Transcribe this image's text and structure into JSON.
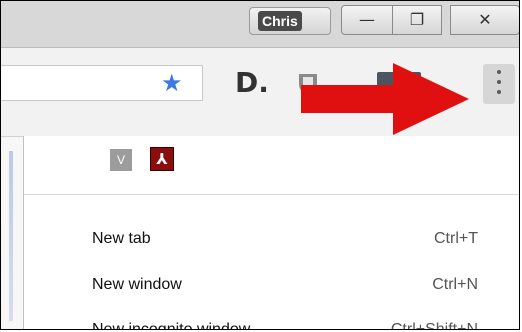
{
  "titlebar": {
    "profile_name": "Chris",
    "minimize_glyph": "—",
    "maximize_glyph": "❐",
    "close_glyph": "✕"
  },
  "toolbar": {
    "star_glyph": "★",
    "extension_d_label": "D."
  },
  "menu": {
    "extensions": [
      {
        "icon": "v-extension-icon",
        "label": "V"
      },
      {
        "icon": "acrobat-pdf-icon",
        "label": "⅄"
      }
    ],
    "items": [
      {
        "label": "New tab",
        "shortcut": "Ctrl+T"
      },
      {
        "label": "New window",
        "shortcut": "Ctrl+N"
      },
      {
        "label": "New incognito window",
        "shortcut": "Ctrl+Shift+N"
      }
    ]
  },
  "colors": {
    "arrow": "#e01010",
    "star": "#3b7ae0",
    "pdf": "#8b0e0e"
  }
}
